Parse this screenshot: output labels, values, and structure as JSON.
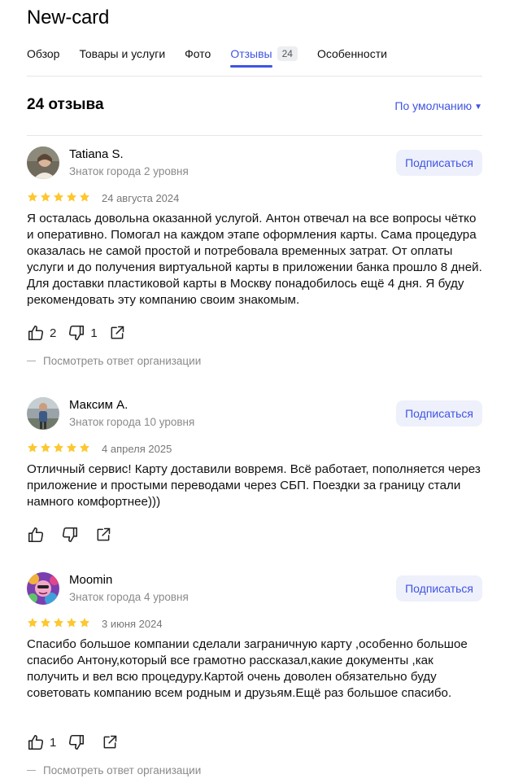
{
  "page": {
    "title": "New-card"
  },
  "tabs": [
    {
      "label": "Обзор"
    },
    {
      "label": "Товары и услуги"
    },
    {
      "label": "Фото"
    },
    {
      "label": "Отзывы",
      "count": "24",
      "active": true
    },
    {
      "label": "Особенности"
    }
  ],
  "reviews_header": {
    "heading": "24 отзыва",
    "sort_label": "По умолчанию"
  },
  "colors": {
    "accent": "#3f54e4",
    "star": "#fdc72f",
    "subscribe_bg": "#eef0fb"
  },
  "reviews": [
    {
      "author": "Tatiana S.",
      "level": "Знаток города 2 уровня",
      "subscribe": "Подписаться",
      "rating": 5,
      "date": "24 августа 2024",
      "text": "Я осталась довольна оказанной услугой. Антон отвечал на все вопросы чётко и оперативно. Помогал на каждом этапе оформления карты. Сама процедура оказалась не самой простой и потребовала временных затрат. От оплаты услуги и до получения виртуальной карты в приложении банка прошло 8 дней. Для доставки пластиковой карты в Москву понадобилось ещё 4 дня. Я буду рекомендовать эту компанию своим знакомым.",
      "likes": "2",
      "dislikes": "1",
      "org_answer": "Посмотреть ответ организации"
    },
    {
      "author": "Максим А.",
      "level": "Знаток города 10 уровня",
      "subscribe": "Подписаться",
      "rating": 5,
      "date": "4 апреля 2025",
      "text": "Отличный сервис! Карту доставили вовремя. Всё работает, пополняется через приложение и простыми переводами через СБП. Поездки за границу стали намного комфортнее)))",
      "likes": "",
      "dislikes": ""
    },
    {
      "author": "Moomin",
      "level": "Знаток города 4 уровня",
      "subscribe": "Подписаться",
      "rating": 5,
      "date": "3 июня 2024",
      "text": "Спасибо большое компании сделали заграничную карту ,особенно большое спасибо Антону,который все грамотно рассказал,какие документы ,как получить и вел всю процедуру.Картой очень доволен обязательно буду советовать компанию всем родным и друзьям.Ещё раз большое спасибо.",
      "likes": "1",
      "dislikes": "",
      "org_answer": "Посмотреть ответ организации"
    }
  ]
}
